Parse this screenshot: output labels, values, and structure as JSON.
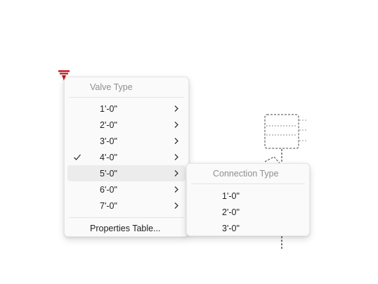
{
  "main_menu": {
    "header": "Valve Type",
    "items": [
      {
        "label": "1'-0\""
      },
      {
        "label": "2'-0\""
      },
      {
        "label": "3'-0\""
      },
      {
        "label": "4'-0\"",
        "checked": true
      },
      {
        "label": "5'-0\"",
        "highlighted": true
      },
      {
        "label": "6'-0\""
      },
      {
        "label": "7'-0\""
      }
    ],
    "footer_item": "Properties Table..."
  },
  "sub_menu": {
    "header": "Connection Type",
    "items": [
      {
        "label": "1'-0\""
      },
      {
        "label": "2'-0\""
      },
      {
        "label": "3'-0\""
      }
    ]
  },
  "colors": {
    "marker": "#c0141c",
    "hover": "#ececec",
    "header_text": "#8f8f8f"
  },
  "icons": {
    "marker": "valve-marker-icon",
    "submenu_arrow": "chevron-right-icon",
    "checked": "checkmark-icon"
  }
}
